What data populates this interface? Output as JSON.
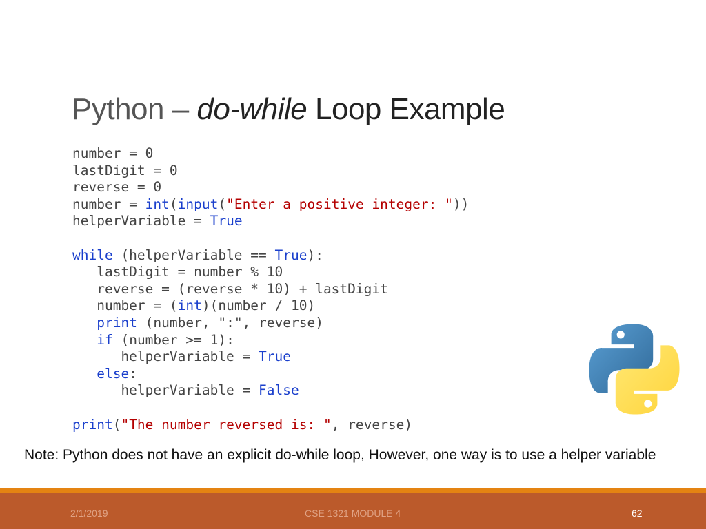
{
  "slide": {
    "title": {
      "prefix": "Python – ",
      "italic": "do-while",
      "suffix": " Loop Example"
    },
    "code_lines": [
      [
        {
          "t": "number = 0"
        }
      ],
      [
        {
          "t": "lastDigit = 0"
        }
      ],
      [
        {
          "t": "reverse = 0"
        }
      ],
      [
        {
          "t": "number = "
        },
        {
          "t": "int",
          "c": "kw"
        },
        {
          "t": "("
        },
        {
          "t": "input",
          "c": "kw"
        },
        {
          "t": "("
        },
        {
          "t": "\"Enter a positive integer: \"",
          "c": "str"
        },
        {
          "t": "))"
        }
      ],
      [
        {
          "t": "helperVariable = "
        },
        {
          "t": "True",
          "c": "kw"
        }
      ],
      [
        {
          "t": ""
        }
      ],
      [
        {
          "t": "while",
          "c": "kw"
        },
        {
          "t": " (helperVariable == "
        },
        {
          "t": "True",
          "c": "kw"
        },
        {
          "t": "):"
        }
      ],
      [
        {
          "t": "   lastDigit = number % 10"
        }
      ],
      [
        {
          "t": "   reverse = (reverse * 10) + lastDigit"
        }
      ],
      [
        {
          "t": "   number = ("
        },
        {
          "t": "int",
          "c": "kw"
        },
        {
          "t": ")(number / 10)"
        }
      ],
      [
        {
          "t": "   "
        },
        {
          "t": "print",
          "c": "kw"
        },
        {
          "t": " (number, \":\", reverse)"
        }
      ],
      [
        {
          "t": "   "
        },
        {
          "t": "if",
          "c": "kw"
        },
        {
          "t": " (number >= 1):"
        }
      ],
      [
        {
          "t": "      helperVariable = "
        },
        {
          "t": "True",
          "c": "kw"
        }
      ],
      [
        {
          "t": "   "
        },
        {
          "t": "else",
          "c": "kw"
        },
        {
          "t": ":"
        }
      ],
      [
        {
          "t": "      helperVariable = "
        },
        {
          "t": "False",
          "c": "kw"
        }
      ],
      [
        {
          "t": ""
        }
      ],
      [
        {
          "t": "print",
          "c": "kw"
        },
        {
          "t": "("
        },
        {
          "t": "\"The number reversed is: \"",
          "c": "str"
        },
        {
          "t": ", reverse)"
        }
      ]
    ],
    "note": "Note: Python does not have an explicit do-while loop, However, one way is to use a helper variable",
    "logo_icon": "python-logo-icon"
  },
  "footer": {
    "date": "2/1/2019",
    "course": "CSE 1321 MODULE 4",
    "page": "62"
  },
  "colors": {
    "keyword": "#1a3fcc",
    "string": "#b40000",
    "footer_bg": "#bb5a2b",
    "footer_stripe": "#e48312",
    "logo_blue": "#3a6fa5",
    "logo_yellow": "#fcd24a"
  }
}
